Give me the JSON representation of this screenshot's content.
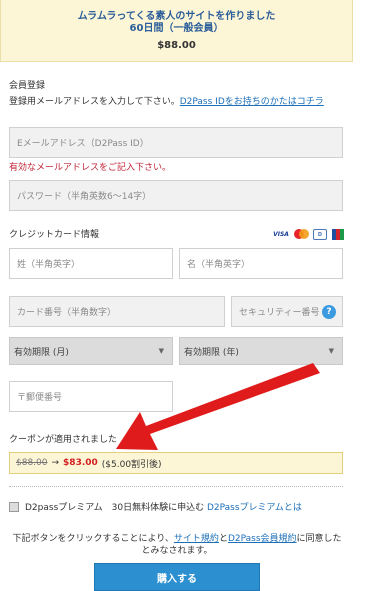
{
  "banner": {
    "title": "ムラムラってくる素人のサイトを作りました",
    "plan": "60日間（一般会員）",
    "price": "$88.00"
  },
  "registration": {
    "heading": "会員登録",
    "instruction": "登録用メールアドレスを入力して下さい。",
    "instruction_link": "D2Pass IDをお持ちのかたはコチラ",
    "email_placeholder": "Eメールアドレス（D2Pass ID）",
    "email_error": "有効なメールアドレスをご記入下さい。",
    "password_placeholder": "パスワード（半角英数6～14字）"
  },
  "credit_card": {
    "heading": "クレジットカード情報",
    "brands": [
      "VISA",
      "mastercard",
      "Diners",
      "JCB"
    ],
    "last_name_placeholder": "姓（半角英字）",
    "first_name_placeholder": "名（半角英字）",
    "card_number_placeholder": "カード番号（半角数字）",
    "security_code_placeholder": "セキュリティー番号",
    "help_icon": "?",
    "expiry_month_label": "有効期限 (月)",
    "expiry_year_label": "有効期限 (年)",
    "zip_placeholder": "〒郵便番号"
  },
  "coupon": {
    "applied_text": "クーポンが適用されました",
    "old_price": "$88.00",
    "arrow": "→",
    "new_price": "$83.00",
    "discount_note": "($5.00割引後)"
  },
  "premium": {
    "label": "D2passプレミアム　30日無料体験に申込む",
    "link": "D2Passプレミアムとは"
  },
  "terms": {
    "prefix": "下記ボタンをクリックすることにより、",
    "site_terms": "サイト規約",
    "and": "と",
    "d2pass_terms": "D2Pass会員規約",
    "suffix": "に同意したとみなされます。"
  },
  "buy_button": "購入する",
  "colors": {
    "accent": "#2c8fd0",
    "error": "#c0263a",
    "price_red": "#d31f1f",
    "banner_bg": "#fdf6d6",
    "annotation_arrow": "#e01b1b"
  }
}
